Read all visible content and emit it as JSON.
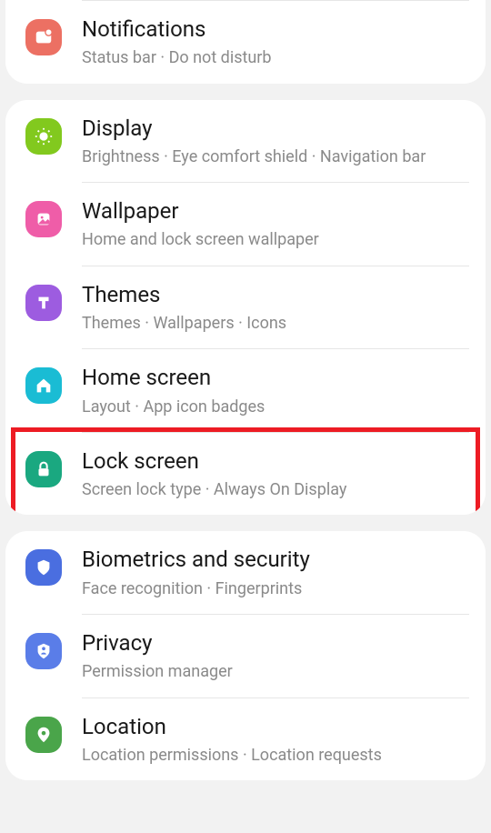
{
  "sections": [
    {
      "items": [
        {
          "icon": "bell",
          "color": "#ec7063",
          "title": "Notifications",
          "subtitle": "Status bar  ·  Do not disturb"
        }
      ]
    },
    {
      "items": [
        {
          "icon": "brightness",
          "color": "#82c91e",
          "title": "Display",
          "subtitle": "Brightness  ·  Eye comfort shield  ·  Navigation bar"
        },
        {
          "icon": "wallpaper",
          "color": "#ef5da8",
          "title": "Wallpaper",
          "subtitle": "Home and lock screen wallpaper"
        },
        {
          "icon": "themes",
          "color": "#9d5ce0",
          "title": "Themes",
          "subtitle": "Themes  ·  Wallpapers  ·  Icons"
        },
        {
          "icon": "home",
          "color": "#1abcd4",
          "title": "Home screen",
          "subtitle": "Layout  ·  App icon badges"
        },
        {
          "icon": "lock",
          "color": "#1aa880",
          "title": "Lock screen",
          "subtitle": "Screen lock type  ·  Always On Display",
          "highlighted": true
        }
      ]
    },
    {
      "items": [
        {
          "icon": "shield",
          "color": "#4a6ee0",
          "title": "Biometrics and security",
          "subtitle": "Face recognition  ·  Fingerprints"
        },
        {
          "icon": "badge",
          "color": "#5a7de8",
          "title": "Privacy",
          "subtitle": "Permission manager"
        },
        {
          "icon": "pin",
          "color": "#4aa54a",
          "title": "Location",
          "subtitle": "Location permissions  ·  Location requests"
        }
      ]
    }
  ]
}
